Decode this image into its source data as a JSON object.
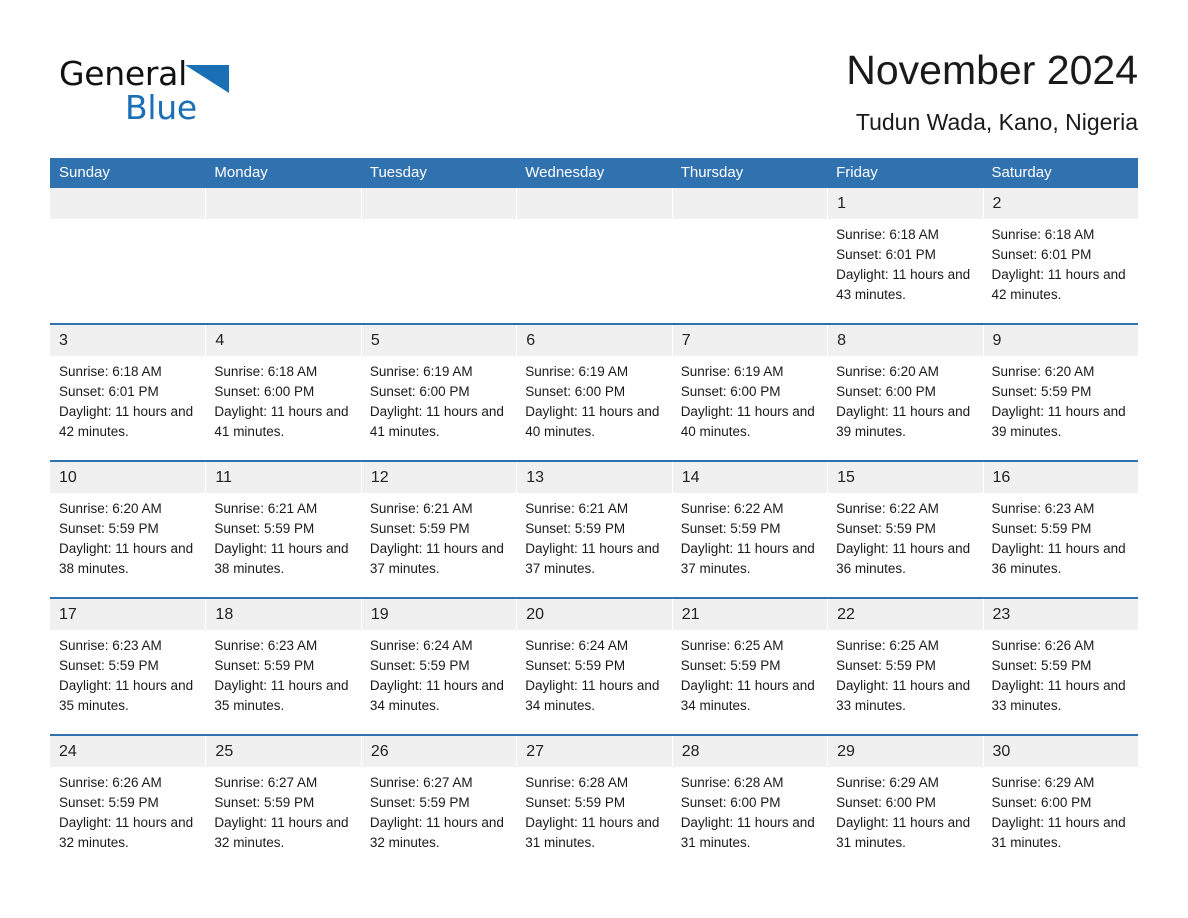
{
  "brand": {
    "word1": "General",
    "word2": "Blue",
    "logo_icon": "triangle-icon",
    "accent_color": "#1a6fb5"
  },
  "header": {
    "month_title": "November 2024",
    "location": "Tudun Wada, Kano, Nigeria"
  },
  "theme": {
    "header_blue": "#3071b0",
    "date_band_gray": "#f0f0f0",
    "text_color": "#1a1a1a",
    "page_background": "#ffffff"
  },
  "calendar": {
    "weekdays": [
      "Sunday",
      "Monday",
      "Tuesday",
      "Wednesday",
      "Thursday",
      "Friday",
      "Saturday"
    ],
    "labels": {
      "sunrise": "Sunrise:",
      "sunset": "Sunset:",
      "daylight": "Daylight:"
    },
    "weeks": [
      [
        {
          "date": "",
          "empty": true
        },
        {
          "date": "",
          "empty": true
        },
        {
          "date": "",
          "empty": true
        },
        {
          "date": "",
          "empty": true
        },
        {
          "date": "",
          "empty": true
        },
        {
          "date": "1",
          "sunrise": "Sunrise: 6:18 AM",
          "sunset": "Sunset: 6:01 PM",
          "daylight": "Daylight: 11 hours and 43 minutes."
        },
        {
          "date": "2",
          "sunrise": "Sunrise: 6:18 AM",
          "sunset": "Sunset: 6:01 PM",
          "daylight": "Daylight: 11 hours and 42 minutes."
        }
      ],
      [
        {
          "date": "3",
          "sunrise": "Sunrise: 6:18 AM",
          "sunset": "Sunset: 6:01 PM",
          "daylight": "Daylight: 11 hours and 42 minutes."
        },
        {
          "date": "4",
          "sunrise": "Sunrise: 6:18 AM",
          "sunset": "Sunset: 6:00 PM",
          "daylight": "Daylight: 11 hours and 41 minutes."
        },
        {
          "date": "5",
          "sunrise": "Sunrise: 6:19 AM",
          "sunset": "Sunset: 6:00 PM",
          "daylight": "Daylight: 11 hours and 41 minutes."
        },
        {
          "date": "6",
          "sunrise": "Sunrise: 6:19 AM",
          "sunset": "Sunset: 6:00 PM",
          "daylight": "Daylight: 11 hours and 40 minutes."
        },
        {
          "date": "7",
          "sunrise": "Sunrise: 6:19 AM",
          "sunset": "Sunset: 6:00 PM",
          "daylight": "Daylight: 11 hours and 40 minutes."
        },
        {
          "date": "8",
          "sunrise": "Sunrise: 6:20 AM",
          "sunset": "Sunset: 6:00 PM",
          "daylight": "Daylight: 11 hours and 39 minutes."
        },
        {
          "date": "9",
          "sunrise": "Sunrise: 6:20 AM",
          "sunset": "Sunset: 5:59 PM",
          "daylight": "Daylight: 11 hours and 39 minutes."
        }
      ],
      [
        {
          "date": "10",
          "sunrise": "Sunrise: 6:20 AM",
          "sunset": "Sunset: 5:59 PM",
          "daylight": "Daylight: 11 hours and 38 minutes."
        },
        {
          "date": "11",
          "sunrise": "Sunrise: 6:21 AM",
          "sunset": "Sunset: 5:59 PM",
          "daylight": "Daylight: 11 hours and 38 minutes."
        },
        {
          "date": "12",
          "sunrise": "Sunrise: 6:21 AM",
          "sunset": "Sunset: 5:59 PM",
          "daylight": "Daylight: 11 hours and 37 minutes."
        },
        {
          "date": "13",
          "sunrise": "Sunrise: 6:21 AM",
          "sunset": "Sunset: 5:59 PM",
          "daylight": "Daylight: 11 hours and 37 minutes."
        },
        {
          "date": "14",
          "sunrise": "Sunrise: 6:22 AM",
          "sunset": "Sunset: 5:59 PM",
          "daylight": "Daylight: 11 hours and 37 minutes."
        },
        {
          "date": "15",
          "sunrise": "Sunrise: 6:22 AM",
          "sunset": "Sunset: 5:59 PM",
          "daylight": "Daylight: 11 hours and 36 minutes."
        },
        {
          "date": "16",
          "sunrise": "Sunrise: 6:23 AM",
          "sunset": "Sunset: 5:59 PM",
          "daylight": "Daylight: 11 hours and 36 minutes."
        }
      ],
      [
        {
          "date": "17",
          "sunrise": "Sunrise: 6:23 AM",
          "sunset": "Sunset: 5:59 PM",
          "daylight": "Daylight: 11 hours and 35 minutes."
        },
        {
          "date": "18",
          "sunrise": "Sunrise: 6:23 AM",
          "sunset": "Sunset: 5:59 PM",
          "daylight": "Daylight: 11 hours and 35 minutes."
        },
        {
          "date": "19",
          "sunrise": "Sunrise: 6:24 AM",
          "sunset": "Sunset: 5:59 PM",
          "daylight": "Daylight: 11 hours and 34 minutes."
        },
        {
          "date": "20",
          "sunrise": "Sunrise: 6:24 AM",
          "sunset": "Sunset: 5:59 PM",
          "daylight": "Daylight: 11 hours and 34 minutes."
        },
        {
          "date": "21",
          "sunrise": "Sunrise: 6:25 AM",
          "sunset": "Sunset: 5:59 PM",
          "daylight": "Daylight: 11 hours and 34 minutes."
        },
        {
          "date": "22",
          "sunrise": "Sunrise: 6:25 AM",
          "sunset": "Sunset: 5:59 PM",
          "daylight": "Daylight: 11 hours and 33 minutes."
        },
        {
          "date": "23",
          "sunrise": "Sunrise: 6:26 AM",
          "sunset": "Sunset: 5:59 PM",
          "daylight": "Daylight: 11 hours and 33 minutes."
        }
      ],
      [
        {
          "date": "24",
          "sunrise": "Sunrise: 6:26 AM",
          "sunset": "Sunset: 5:59 PM",
          "daylight": "Daylight: 11 hours and 32 minutes."
        },
        {
          "date": "25",
          "sunrise": "Sunrise: 6:27 AM",
          "sunset": "Sunset: 5:59 PM",
          "daylight": "Daylight: 11 hours and 32 minutes."
        },
        {
          "date": "26",
          "sunrise": "Sunrise: 6:27 AM",
          "sunset": "Sunset: 5:59 PM",
          "daylight": "Daylight: 11 hours and 32 minutes."
        },
        {
          "date": "27",
          "sunrise": "Sunrise: 6:28 AM",
          "sunset": "Sunset: 5:59 PM",
          "daylight": "Daylight: 11 hours and 31 minutes."
        },
        {
          "date": "28",
          "sunrise": "Sunrise: 6:28 AM",
          "sunset": "Sunset: 6:00 PM",
          "daylight": "Daylight: 11 hours and 31 minutes."
        },
        {
          "date": "29",
          "sunrise": "Sunrise: 6:29 AM",
          "sunset": "Sunset: 6:00 PM",
          "daylight": "Daylight: 11 hours and 31 minutes."
        },
        {
          "date": "30",
          "sunrise": "Sunrise: 6:29 AM",
          "sunset": "Sunset: 6:00 PM",
          "daylight": "Daylight: 11 hours and 31 minutes."
        }
      ]
    ]
  }
}
